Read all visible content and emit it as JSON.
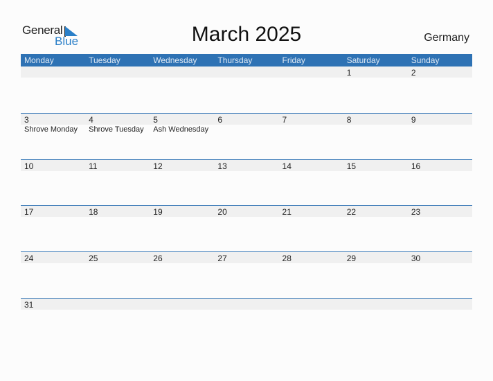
{
  "logo": {
    "general": "General",
    "blue": "Blue"
  },
  "title": "March 2025",
  "country": "Germany",
  "colors": {
    "header": "#2e72b4",
    "strip": "#f0f0f0",
    "brand": "#2a7fc8"
  },
  "weekdays": [
    "Monday",
    "Tuesday",
    "Wednesday",
    "Thursday",
    "Friday",
    "Saturday",
    "Sunday"
  ],
  "weeks": [
    [
      {
        "d": ""
      },
      {
        "d": ""
      },
      {
        "d": ""
      },
      {
        "d": ""
      },
      {
        "d": ""
      },
      {
        "d": "1"
      },
      {
        "d": "2"
      }
    ],
    [
      {
        "d": "3",
        "h": "Shrove Monday"
      },
      {
        "d": "4",
        "h": "Shrove Tuesday"
      },
      {
        "d": "5",
        "h": "Ash Wednesday"
      },
      {
        "d": "6"
      },
      {
        "d": "7"
      },
      {
        "d": "8"
      },
      {
        "d": "9"
      }
    ],
    [
      {
        "d": "10"
      },
      {
        "d": "11"
      },
      {
        "d": "12"
      },
      {
        "d": "13"
      },
      {
        "d": "14"
      },
      {
        "d": "15"
      },
      {
        "d": "16"
      }
    ],
    [
      {
        "d": "17"
      },
      {
        "d": "18"
      },
      {
        "d": "19"
      },
      {
        "d": "20"
      },
      {
        "d": "21"
      },
      {
        "d": "22"
      },
      {
        "d": "23"
      }
    ],
    [
      {
        "d": "24"
      },
      {
        "d": "25"
      },
      {
        "d": "26"
      },
      {
        "d": "27"
      },
      {
        "d": "28"
      },
      {
        "d": "29"
      },
      {
        "d": "30"
      }
    ],
    [
      {
        "d": "31"
      },
      {
        "d": ""
      },
      {
        "d": ""
      },
      {
        "d": ""
      },
      {
        "d": ""
      },
      {
        "d": ""
      },
      {
        "d": ""
      }
    ]
  ]
}
